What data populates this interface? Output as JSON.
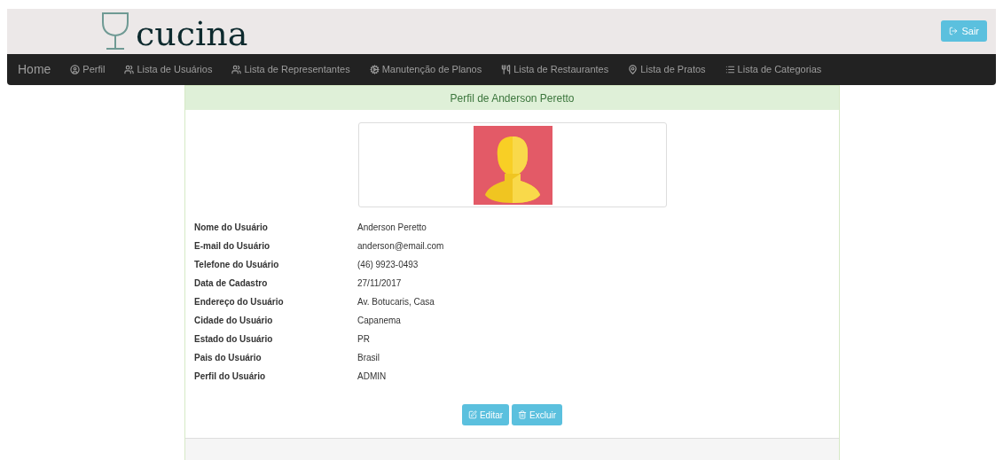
{
  "header": {
    "logo": "cucina",
    "logout_button": "Sair"
  },
  "nav": {
    "brand": "Home",
    "items": [
      {
        "label": "Perfil"
      },
      {
        "label": "Lista de Usuários"
      },
      {
        "label": "Lista de Representantes"
      },
      {
        "label": "Manutenção de Planos"
      },
      {
        "label": "Lista de Restaurantes"
      },
      {
        "label": "Lista de Pratos"
      },
      {
        "label": "Lista de Categorias"
      }
    ]
  },
  "panel": {
    "title": "Perfil de Anderson Peretto",
    "fields": [
      {
        "label": "Nome do Usuário",
        "value": "Anderson Peretto"
      },
      {
        "label": "E-mail do Usuário",
        "value": "anderson@email.com"
      },
      {
        "label": "Telefone do Usuário",
        "value": "(46) 9923-0493"
      },
      {
        "label": "Data de Cadastro",
        "value": "27/11/2017"
      },
      {
        "label": "Endereço do Usuário",
        "value": "Av. Botucaris, Casa"
      },
      {
        "label": "Cidade do Usuário",
        "value": "Capanema"
      },
      {
        "label": "Estado do Usuário",
        "value": "PR"
      },
      {
        "label": "Pais do Usuário",
        "value": "Brasil"
      },
      {
        "label": "Perfil do Usuário",
        "value": "ADMIN"
      }
    ],
    "buttons": [
      {
        "label": "Editar"
      },
      {
        "label": "Excluir"
      }
    ]
  }
}
